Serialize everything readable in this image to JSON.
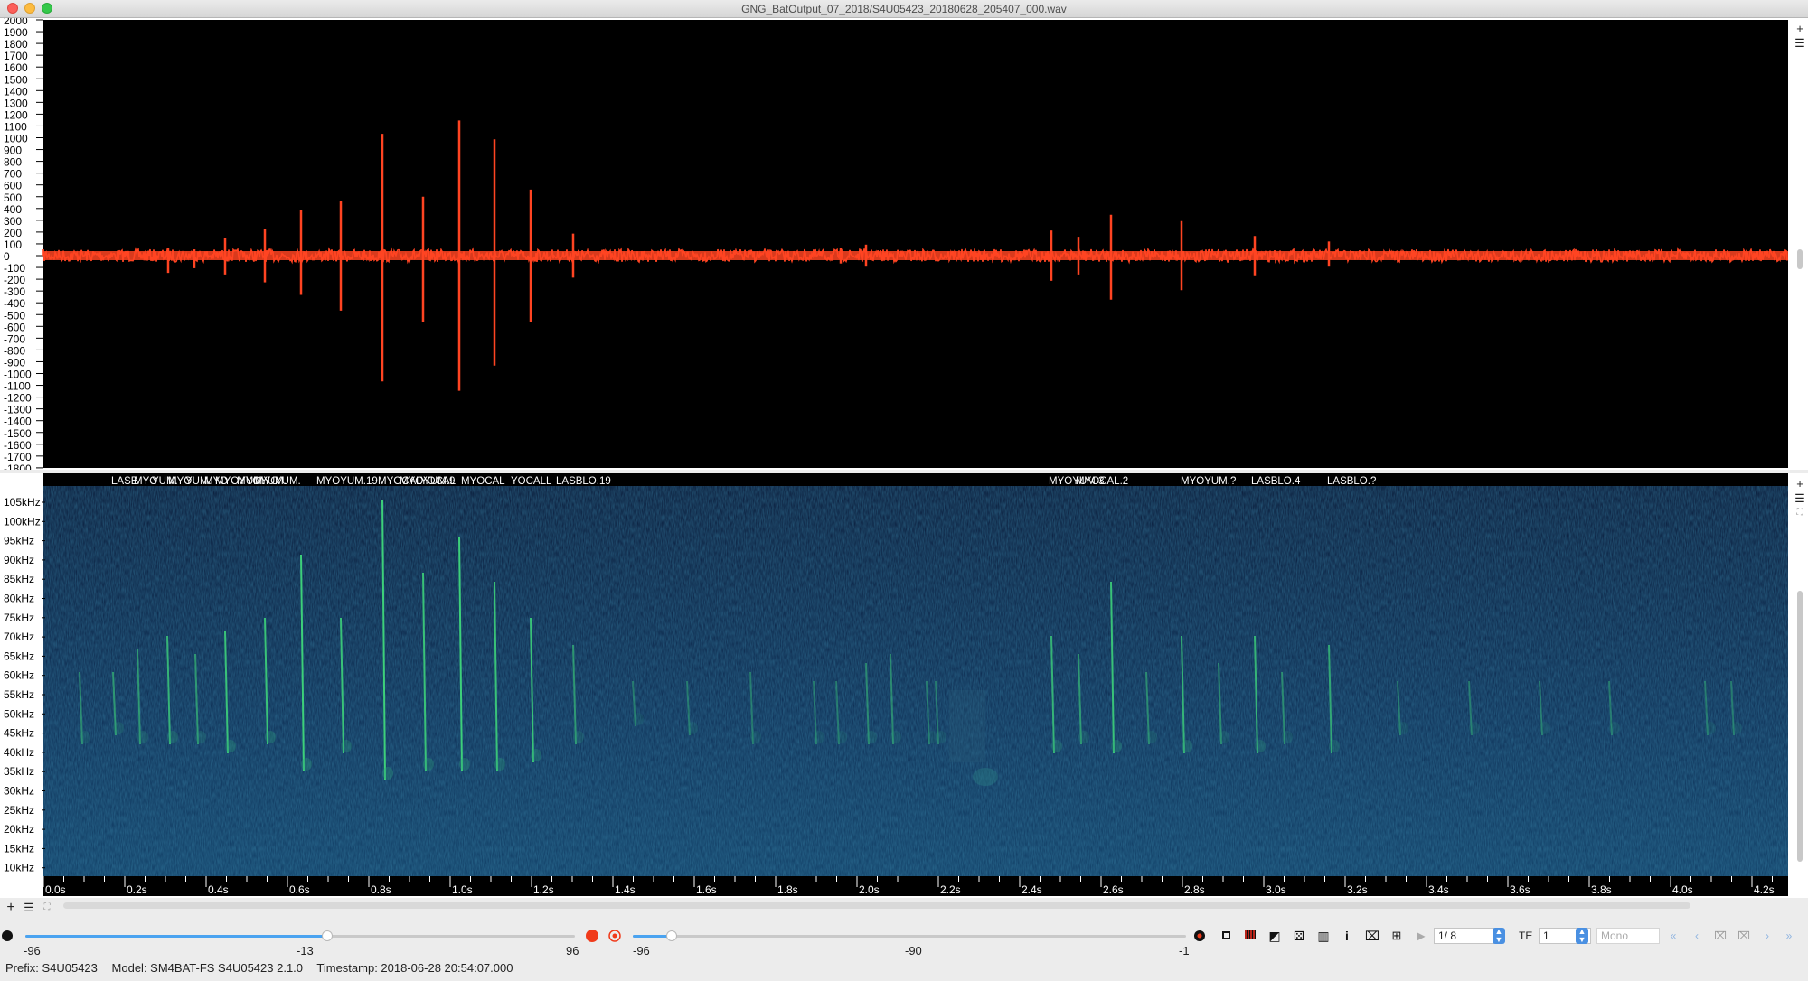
{
  "window": {
    "title": "GNG_BatOutput_07_2018/S4U05423_20180628_205407_000.wav"
  },
  "waveform": {
    "y_axis_labels": [
      "2000",
      "1900",
      "1800",
      "1700",
      "1600",
      "1500",
      "1400",
      "1300",
      "1200",
      "1100",
      "1000",
      "900",
      "800",
      "700",
      "600",
      "500",
      "400",
      "300",
      "200",
      "100",
      "0",
      "-100",
      "-200",
      "-300",
      "-400",
      "-500",
      "-600",
      "-700",
      "-800",
      "-900",
      "-1000",
      "-1100",
      "-1200",
      "-1300",
      "-1400",
      "-1500",
      "-1600",
      "-1700",
      "-1800"
    ],
    "color": "#ff4422",
    "background": "#000000"
  },
  "spectrogram": {
    "freq_labels": [
      "105kHz",
      "100kHz",
      "95kHz",
      "90kHz",
      "85kHz",
      "80kHz",
      "75kHz",
      "70kHz",
      "65kHz",
      "60kHz",
      "55kHz",
      "50kHz",
      "45kHz",
      "40kHz",
      "35kHz",
      "30kHz",
      "25kHz",
      "20kHz",
      "15kHz",
      "10kHz"
    ],
    "time_labels": [
      "0.0s",
      "0.2s",
      "0.4s",
      "0.6s",
      "0.8s",
      "1.0s",
      "1.2s",
      "1.4s",
      "1.6s",
      "1.8s",
      "2.0s",
      "2.2s",
      "2.4s",
      "2.6s",
      "2.8s",
      "3.0s",
      "3.2s",
      "3.4s",
      "3.6s",
      "3.8s",
      "4.0s",
      "4.2s"
    ],
    "annotation_labels": [
      "LASE",
      "MYO",
      "YUM.",
      "MYO",
      "YUM.",
      "MYO",
      "MYOYUM.",
      "MYOYUM.",
      "MYO",
      "YUM.",
      "MYOYUM.19",
      "MYOCAL",
      "MYOYUM.9",
      "YOCAL",
      "MYOCAL",
      "YOCALL",
      "LASBLO.19",
      "MYOYUM.3",
      "MYOCAL.2",
      "MYOYUM.?",
      "LASBLO.4",
      "LASBLO.?"
    ],
    "background": "#0b1d3a"
  },
  "controls": {
    "gain": {
      "min": "-96",
      "mid": "-13",
      "max": "96",
      "value": 0.55
    },
    "threshold": {
      "min": "-96",
      "mid": "-90",
      "max": "-1",
      "value": 0.07
    },
    "page_counter": "1/ 8",
    "te_label": "TE",
    "te_value": "1",
    "channel": "Mono",
    "info_icon_label": "i"
  },
  "status": {
    "prefix": "Prefix: S4U05423",
    "model": "Model: SM4BAT-FS S4U05423 2.1.0",
    "timestamp": "Timestamp: 2018-06-28 20:54:07.000"
  }
}
